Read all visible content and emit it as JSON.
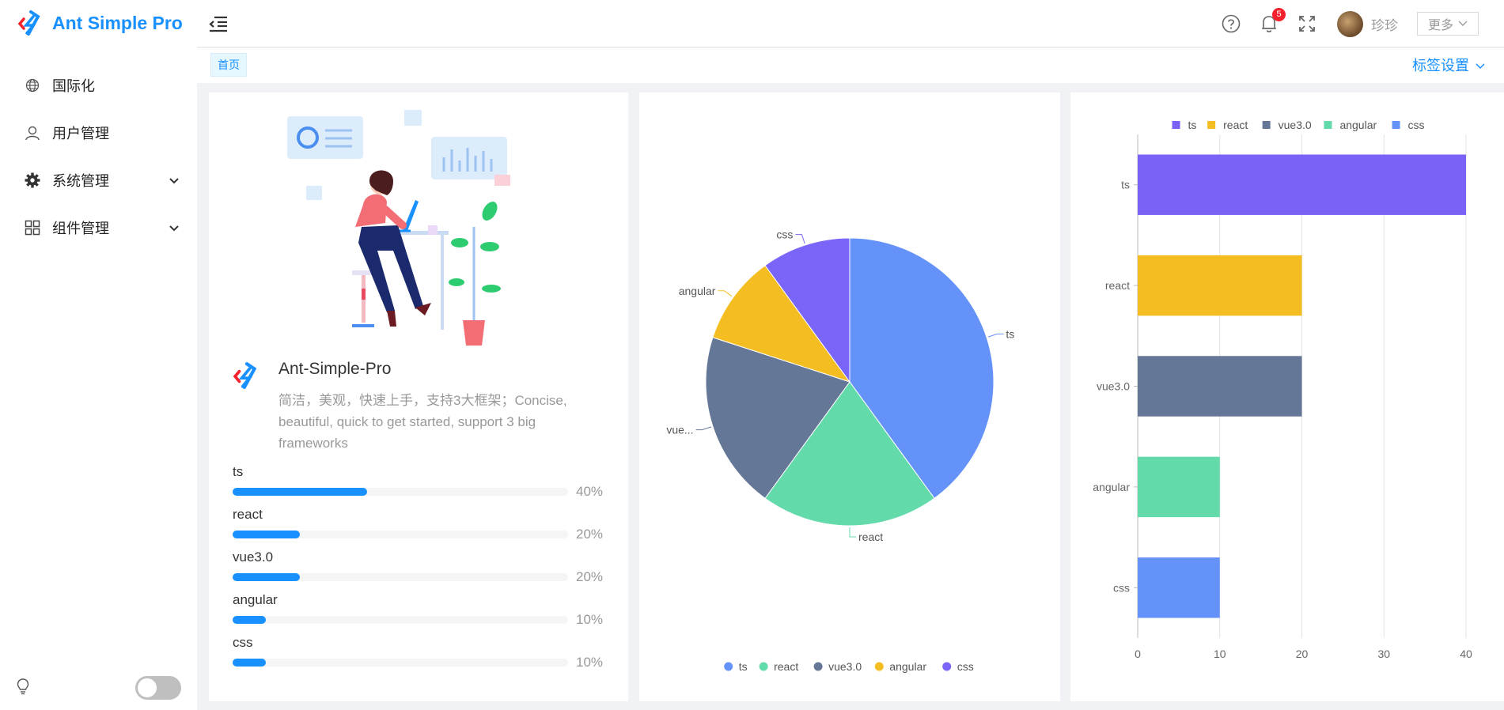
{
  "app": {
    "title": "Ant Simple Pro"
  },
  "sidebar": {
    "items": [
      {
        "label": "国际化",
        "icon": "globe-icon"
      },
      {
        "label": "用户管理",
        "icon": "user-icon"
      },
      {
        "label": "系统管理",
        "icon": "gear-icon",
        "expandable": true
      },
      {
        "label": "组件管理",
        "icon": "appstore-icon",
        "expandable": true
      }
    ]
  },
  "header": {
    "notifications_count": "5",
    "user_name": "珍珍",
    "more_label": "更多"
  },
  "tags": {
    "items": [
      "首页"
    ],
    "settings_label": "标签设置"
  },
  "project": {
    "title": "Ant-Simple-Pro",
    "description": "简洁，美观，快速上手，支持3大框架；Concise, beautiful, quick to get started, support 3 big frameworks"
  },
  "skills": [
    {
      "name": "ts",
      "percent": 40,
      "label": "40%"
    },
    {
      "name": "react",
      "percent": 20,
      "label": "20%"
    },
    {
      "name": "vue3.0",
      "percent": 20,
      "label": "20%"
    },
    {
      "name": "angular",
      "percent": 10,
      "label": "10%"
    },
    {
      "name": "css",
      "percent": 10,
      "label": "10%"
    }
  ],
  "colors": {
    "accent": "#1890ff",
    "ts": "#6592f8",
    "react": "#62daaa",
    "vue": "#657797",
    "angular": "#f4be22",
    "css": "#7965f8",
    "bar_ts": "#7b62f7"
  },
  "chart_data": [
    {
      "type": "pie",
      "categories": [
        "ts",
        "react",
        "vue3.0",
        "angular",
        "css"
      ],
      "values": [
        40,
        20,
        20,
        10,
        10
      ],
      "slice_labels": [
        "ts",
        "react",
        "vue...",
        "angular",
        "css"
      ],
      "legend": {
        "position": "bottom",
        "items": [
          "ts",
          "react",
          "vue3.0",
          "angular",
          "css"
        ]
      }
    },
    {
      "type": "bar",
      "orientation": "horizontal",
      "categories": [
        "ts",
        "react",
        "vue3.0",
        "angular",
        "css"
      ],
      "values": [
        40,
        20,
        20,
        10,
        10
      ],
      "xlim": [
        0,
        40
      ],
      "xticks": [
        "0",
        "10",
        "20",
        "30",
        "40"
      ],
      "grid": true,
      "legend": {
        "position": "top",
        "items": [
          "ts",
          "react",
          "vue3.0",
          "angular",
          "css"
        ]
      }
    }
  ]
}
